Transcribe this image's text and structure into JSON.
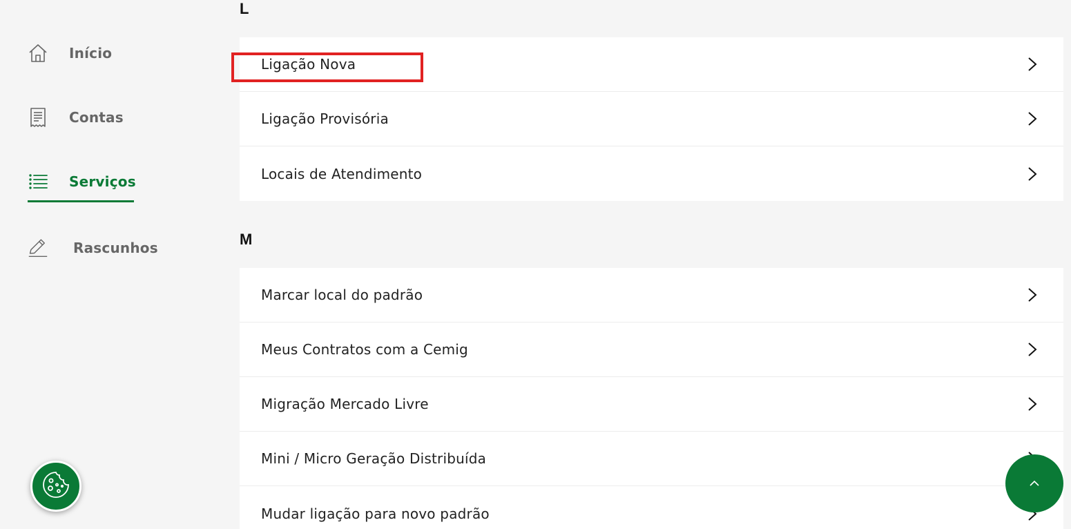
{
  "sidebar": {
    "items": [
      {
        "label": "Início",
        "icon": "home-icon",
        "active": false
      },
      {
        "label": "Contas",
        "icon": "receipt-icon",
        "active": false
      },
      {
        "label": "Serviços",
        "icon": "list-icon",
        "active": true
      },
      {
        "label": "Rascunhos",
        "icon": "pencil-icon",
        "active": false
      }
    ]
  },
  "sections": [
    {
      "letter": "L",
      "items": [
        {
          "label": "Ligação Nova"
        },
        {
          "label": "Ligação Provisória"
        },
        {
          "label": "Locais de Atendimento"
        }
      ]
    },
    {
      "letter": "M",
      "items": [
        {
          "label": "Marcar local do padrão"
        },
        {
          "label": "Meus Contratos com a Cemig"
        },
        {
          "label": "Migração Mercado Livre"
        },
        {
          "label": "Mini / Micro Geração Distribuída"
        },
        {
          "label": "Mudar ligação para novo padrão"
        }
      ]
    }
  ],
  "highlight": {
    "target": "Ligação Nova",
    "color": "#e12222"
  },
  "colors": {
    "brand_green": "#0a7a36",
    "background": "#f5f5f5",
    "sidebar_text": "#666666"
  },
  "icons": {
    "cookie_button": "cookie-icon",
    "scroll_top": "chevron-up-icon",
    "list_item": "chevron-right-icon"
  }
}
